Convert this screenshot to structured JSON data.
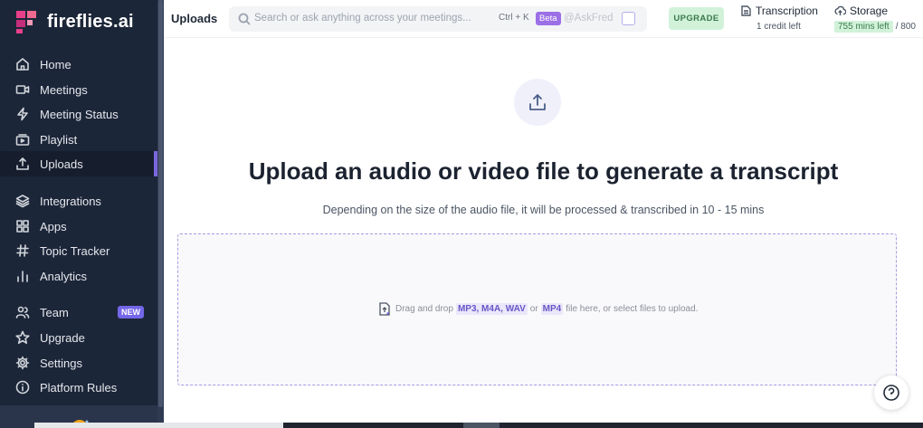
{
  "brand": {
    "name": "fireflies.ai"
  },
  "sidebar": {
    "items": [
      {
        "label": "Home",
        "icon": "home-icon"
      },
      {
        "label": "Meetings",
        "icon": "video-icon"
      },
      {
        "label": "Meeting Status",
        "icon": "bolt-icon"
      },
      {
        "label": "Playlist",
        "icon": "playlist-icon"
      },
      {
        "label": "Uploads",
        "icon": "upload-icon",
        "active": true
      },
      {
        "label": "Integrations",
        "icon": "layers-icon"
      },
      {
        "label": "Apps",
        "icon": "grid-icon"
      },
      {
        "label": "Topic Tracker",
        "icon": "hash-icon"
      },
      {
        "label": "Analytics",
        "icon": "bar-chart-icon"
      },
      {
        "label": "Team",
        "icon": "users-icon",
        "badge": "NEW"
      },
      {
        "label": "Upgrade",
        "icon": "star-icon"
      },
      {
        "label": "Settings",
        "icon": "gear-icon"
      },
      {
        "label": "Platform Rules",
        "icon": "info-icon"
      }
    ]
  },
  "header": {
    "title": "Uploads",
    "search_placeholder": "Search or ask anything across your meetings...",
    "shortcut": "Ctrl + K",
    "beta": "Beta",
    "askfred": "@AskFred",
    "upgrade_label": "UPGRADE",
    "transcription": {
      "title": "Transcription",
      "sub": "1 credit left"
    },
    "storage": {
      "title": "Storage",
      "left": "755 mins left",
      "total": "/ 800"
    }
  },
  "main": {
    "headline": "Upload an audio or video file to generate a transcript",
    "subline": "Depending on the size of the audio file, it will be processed & transcribed in 10 - 15 mins",
    "drop": {
      "prefix": "Drag and drop",
      "formats_audio": "MP3, M4A, WAV",
      "or": "or",
      "format_video": "MP4",
      "suffix": "file here, or select files to upload."
    }
  },
  "colors": {
    "sidebar": "#1c2639",
    "accent": "#7466e8",
    "upgrade_bg": "#d1f2d9"
  }
}
